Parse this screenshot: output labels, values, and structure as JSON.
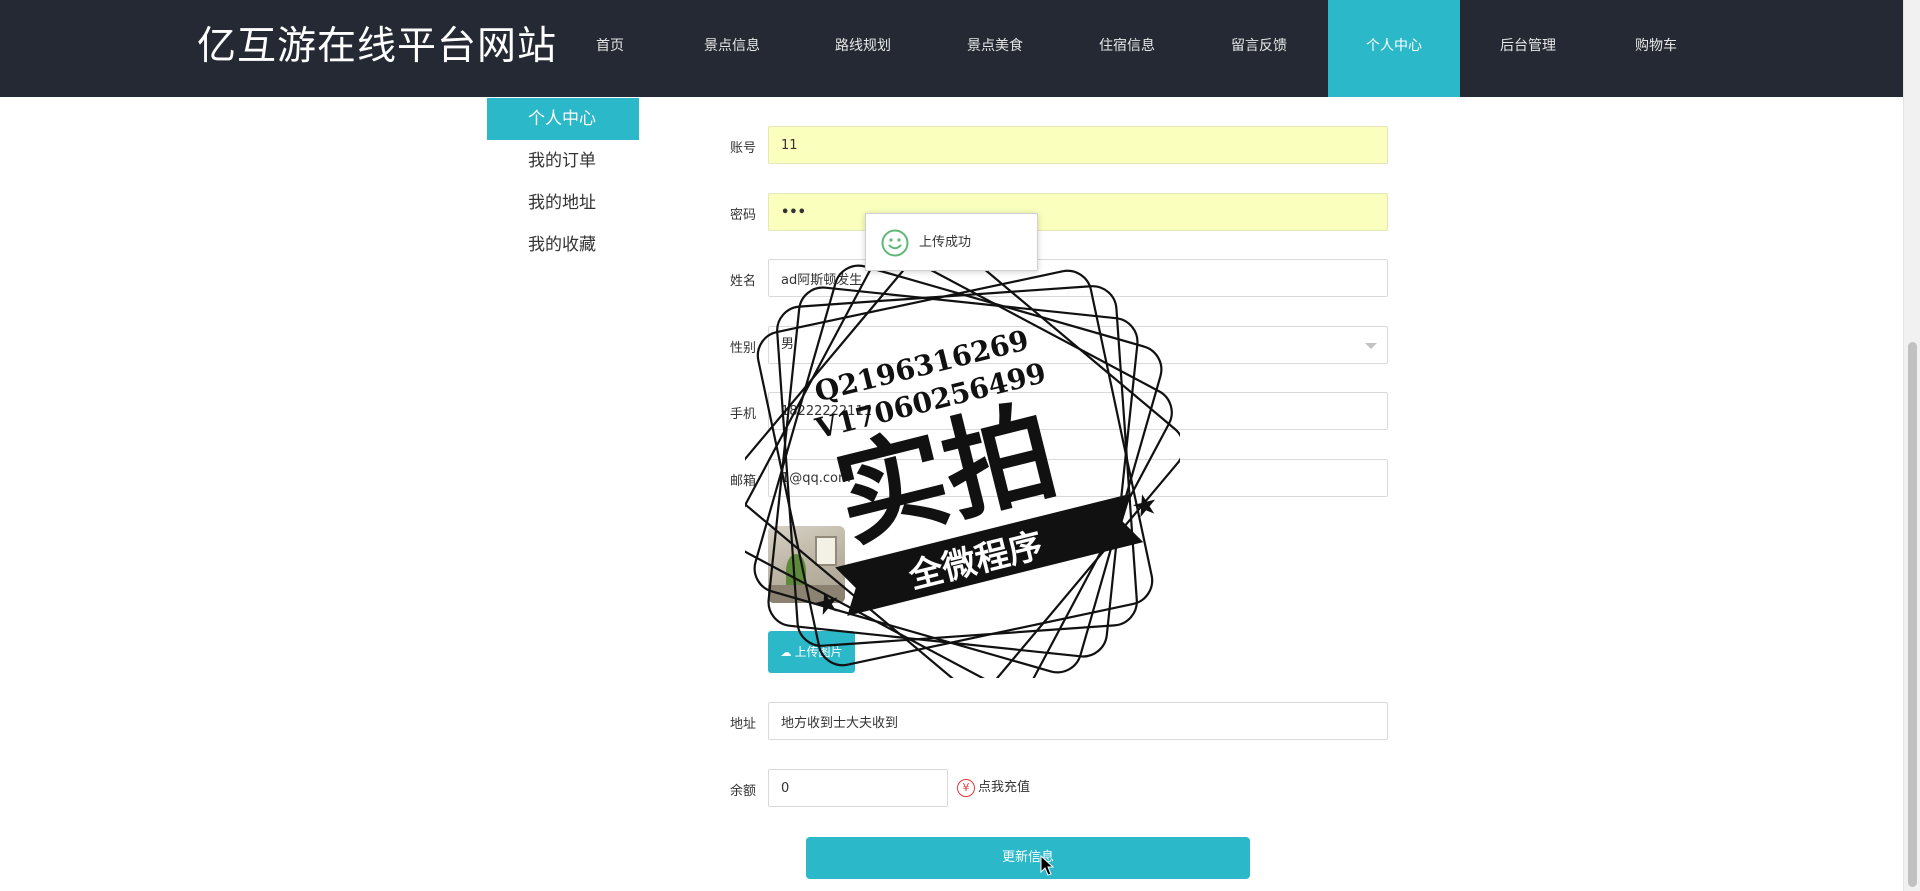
{
  "header": {
    "site_title": "亿互游在线平台网站",
    "nav": [
      {
        "label": "首页"
      },
      {
        "label": "景点信息"
      },
      {
        "label": "路线规划"
      },
      {
        "label": "景点美食"
      },
      {
        "label": "住宿信息"
      },
      {
        "label": "留言反馈"
      },
      {
        "label": "个人中心",
        "active": true
      },
      {
        "label": "后台管理"
      },
      {
        "label": "购物车"
      }
    ]
  },
  "sidebar": {
    "items": [
      {
        "label": "个人中心",
        "active": true
      },
      {
        "label": "我的订单"
      },
      {
        "label": "我的地址"
      },
      {
        "label": "我的收藏"
      }
    ]
  },
  "form": {
    "account": {
      "label": "账号",
      "value": "11"
    },
    "password": {
      "label": "密码",
      "value": "•••"
    },
    "name": {
      "label": "姓名",
      "value": "ad阿斯顿发生"
    },
    "gender": {
      "label": "性别",
      "value": "男"
    },
    "phone": {
      "label": "手机",
      "value": "18222222111"
    },
    "email": {
      "label": "邮箱",
      "value": "1@qq.com"
    },
    "upload_button": "上传图片",
    "address": {
      "label": "地址",
      "value": "地方收到士大夫收到"
    },
    "balance": {
      "label": "余额",
      "value": "0"
    },
    "recharge_link": "点我充值",
    "update_button": "更新信息"
  },
  "toast": {
    "message": "上传成功"
  },
  "watermark": {
    "line1": "Q2196316269",
    "line2": "V17060256499",
    "main": "实拍",
    "banner": "全微程序"
  },
  "colors": {
    "header_bg": "#242934",
    "accent": "#2bb8c9",
    "autofill_bg": "#faffbd",
    "recharge_icon": "#e23b3b"
  }
}
